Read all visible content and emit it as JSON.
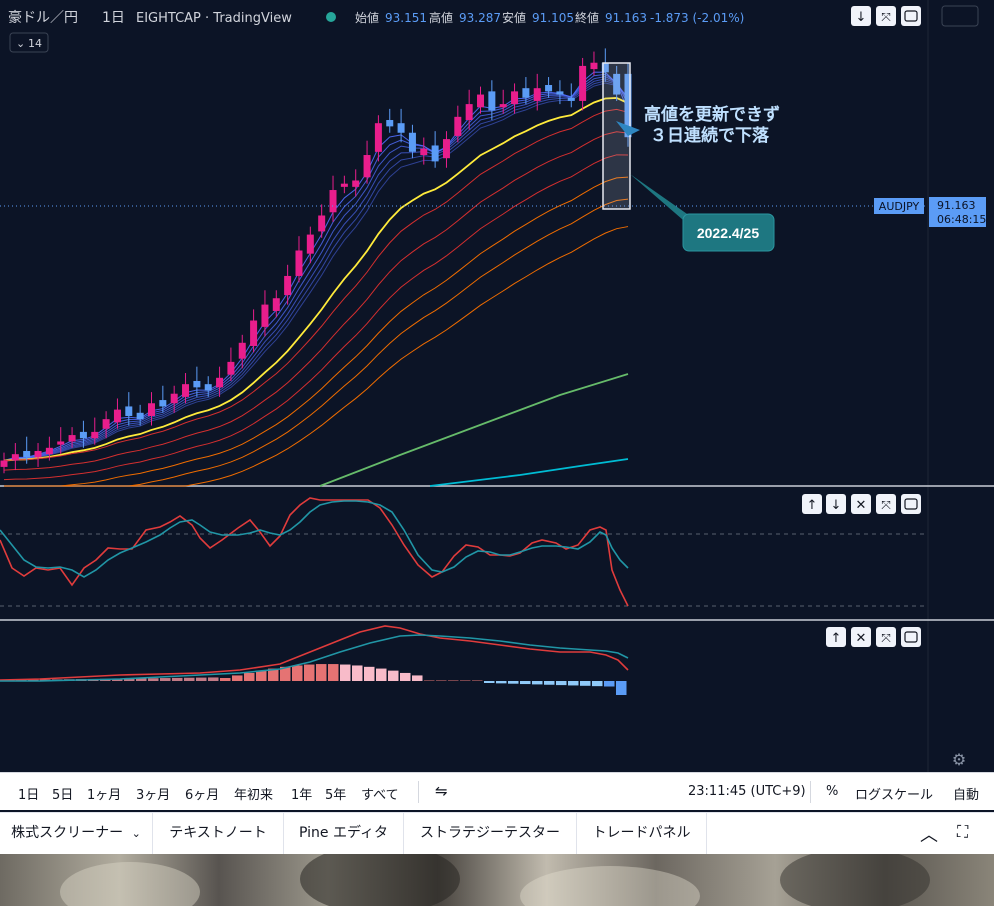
{
  "header": {
    "symbol": "豪ドル／円",
    "interval": "1日",
    "source": "EIGHTCAP · TradingView",
    "ohlc": [
      {
        "label": "始値",
        "value": "93.151"
      },
      {
        "label": "高値",
        "value": "93.287"
      },
      {
        "label": "安値",
        "value": "91.105"
      },
      {
        "label": "終値",
        "value": "91.163"
      }
    ],
    "change": "-1.873 (-2.01%)",
    "indicator_toggle": "14"
  },
  "price_tag": {
    "symbol": "AUDJPY",
    "price": "91.163",
    "countdown": "06:48:15"
  },
  "annotation": {
    "line1": "高値を更新できず",
    "line2": "３日連続で下落",
    "callout_date": "2022.4/25"
  },
  "colors": {
    "up": "#e91e8c",
    "down": "#5b9cf6",
    "sma200": "#00bcd4",
    "sma100": "#66bb6a",
    "pivot": "#ffeb3b",
    "background": "#0c1426"
  },
  "chart_data": {
    "type": "candlestick",
    "symbol": "AUDJPY",
    "last": 91.163,
    "open": 93.151,
    "high": 93.287,
    "low": 91.105,
    "series_close": [
      81.0,
      81.2,
      81.1,
      81.3,
      81.4,
      81.6,
      81.8,
      81.7,
      81.9,
      82.3,
      82.6,
      82.4,
      82.3,
      82.8,
      82.7,
      83.1,
      83.4,
      83.3,
      83.2,
      83.6,
      84.1,
      84.7,
      85.4,
      85.9,
      86.1,
      86.8,
      87.6,
      88.1,
      88.7,
      89.5,
      89.7,
      89.8,
      90.6,
      91.6,
      91.5,
      91.3,
      90.7,
      90.8,
      90.4,
      91.1,
      91.8,
      92.2,
      92.5,
      92.0,
      92.2,
      92.6,
      92.4,
      92.7,
      92.6,
      92.5,
      92.3,
      93.4,
      93.5,
      93.2,
      92.5,
      91.16
    ],
    "series_open": [
      80.8,
      81.0,
      81.3,
      81.1,
      81.2,
      81.5,
      81.6,
      81.9,
      81.7,
      82.0,
      82.2,
      82.7,
      82.5,
      82.4,
      82.9,
      82.8,
      83.0,
      83.5,
      83.4,
      83.3,
      83.7,
      84.2,
      84.6,
      85.2,
      85.7,
      86.2,
      86.8,
      87.5,
      88.2,
      88.8,
      89.6,
      89.6,
      89.9,
      90.7,
      91.7,
      91.6,
      91.3,
      90.6,
      90.9,
      90.5,
      91.2,
      91.7,
      92.1,
      92.6,
      92.1,
      92.2,
      92.7,
      92.3,
      92.8,
      92.6,
      92.4,
      92.3,
      93.3,
      93.5,
      93.15,
      93.15
    ],
    "macd_line": [
      0.35,
      0.4,
      0.45,
      0.5,
      0.55,
      0.6,
      0.7,
      0.8,
      0.9,
      1.05,
      1.15,
      1.25,
      1.3,
      1.28,
      1.22,
      1.15,
      1.05,
      0.95,
      0.85,
      0.72
    ],
    "signal_line": [
      0.2,
      0.25,
      0.3,
      0.35,
      0.42,
      0.5,
      0.6,
      0.7,
      0.85,
      1.0,
      1.1,
      1.15,
      1.17,
      1.15,
      1.1,
      1.05,
      1.0,
      0.96,
      0.92,
      0.86
    ]
  },
  "toolbar": {
    "ranges": [
      "1日",
      "5日",
      "1ヶ月",
      "3ヶ月",
      "6ヶ月",
      "年初来",
      "1年",
      "5年",
      "すべて"
    ],
    "time": "23:11:45 (UTC+9)",
    "percent": "%",
    "log": "ログスケール",
    "auto": "自動"
  },
  "bottom_tabs": [
    "株式スクリーナー",
    "テキストノート",
    "Pine エディタ",
    "ストラテジーテスター",
    "トレードパネル"
  ]
}
